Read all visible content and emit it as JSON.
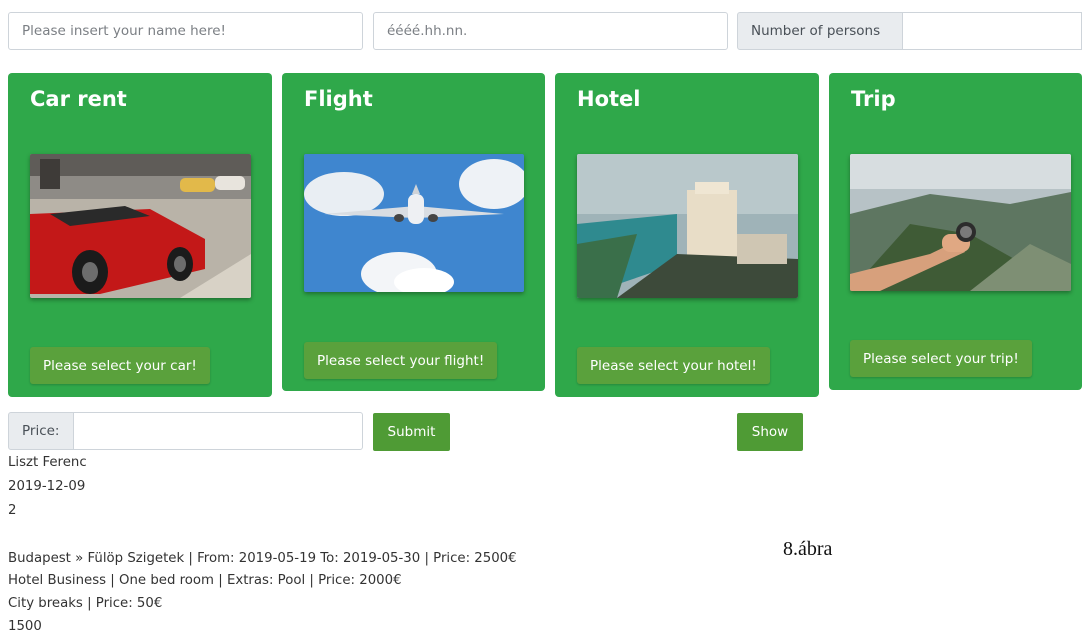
{
  "form": {
    "name_placeholder": "Please insert your name here!",
    "date_placeholder": "éééé.hh.nn.",
    "persons_label": "Number of persons",
    "persons_value": ""
  },
  "cards": [
    {
      "title": "Car rent",
      "button": "Please select your car!",
      "image": "red sports car photo"
    },
    {
      "title": "Flight",
      "button": "Please select your flight!",
      "image": "airplane in sky photo"
    },
    {
      "title": "Hotel",
      "button": "Please select your hotel!",
      "image": "seaside hotel photo"
    },
    {
      "title": "Trip",
      "button": "Please select your trip!",
      "image": "hand holding compass over mountains photo"
    }
  ],
  "price": {
    "label": "Price:",
    "value": "",
    "submit_label": "Submit",
    "show_label": "Show"
  },
  "output": {
    "lines": [
      "Liszt Ferenc",
      "2019-12-09",
      "2",
      "Budapest » Fülöp Szigetek | From: 2019-05-19 To: 2019-05-30 | Price: 2500€",
      "Hotel Business | One bed room | Extras: Pool | Price: 2000€",
      "City breaks | Price: 50€",
      "1500"
    ]
  },
  "caption": "8.ábra",
  "colors": {
    "card_green": "#2fa84a",
    "button_green": "#5aa13c",
    "action_green": "#4f9b35"
  }
}
